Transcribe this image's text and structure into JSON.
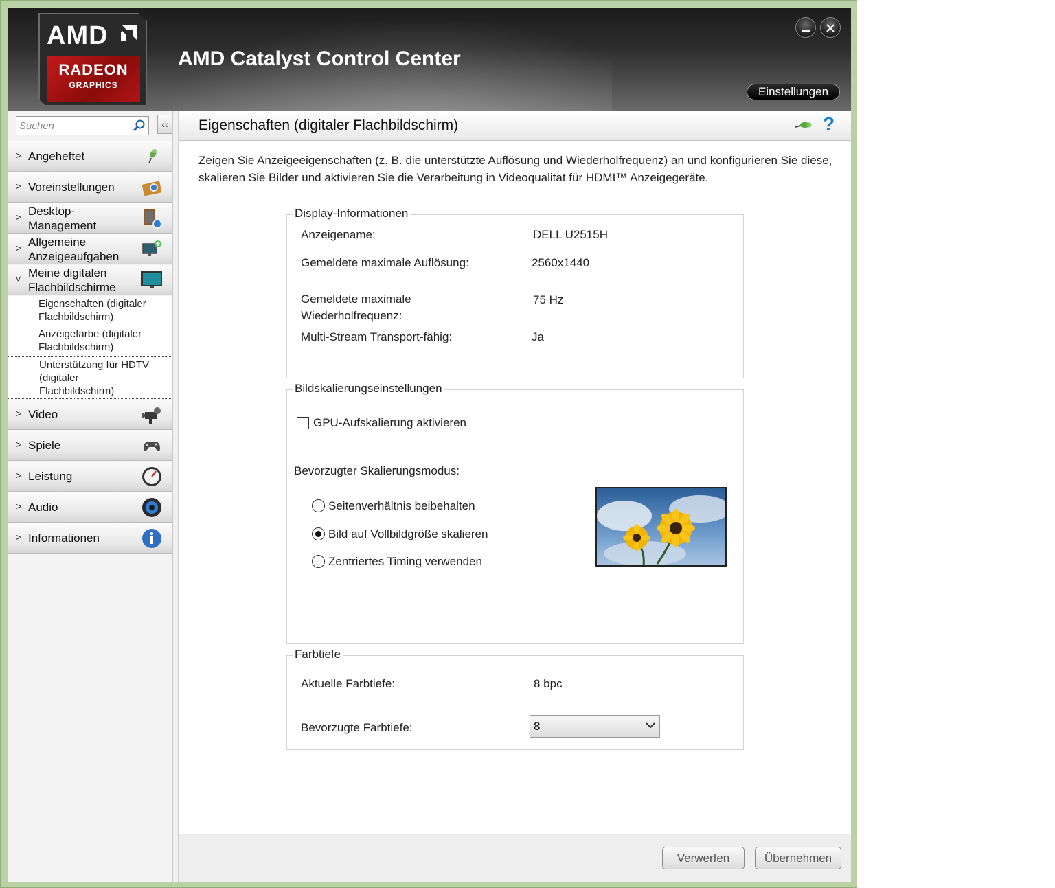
{
  "header": {
    "app_title": "AMD Catalyst Control Center",
    "logo_amd": "AMD",
    "logo_radeon": "RADEON",
    "logo_graphics": "GRAPHICS",
    "minimize_icon": "minimize-icon",
    "close_icon": "close-icon",
    "settings_label": "Einstellungen"
  },
  "sidebar": {
    "search_placeholder": "Suchen",
    "collapse_glyph": "‹‹",
    "items": [
      {
        "label": "Angeheftet",
        "icon": "pin-icon",
        "expanded": false
      },
      {
        "label": "Voreinstellungen",
        "icon": "preset-icon",
        "expanded": false
      },
      {
        "label": "Desktop-Management",
        "line1": "Desktop-",
        "line2": "Management",
        "icon": "desktop-management-icon",
        "expanded": false
      },
      {
        "label": "Allgemeine Anzeigeaufgaben",
        "line1": "Allgemeine",
        "line2": "Anzeigeaufgaben",
        "icon": "display-tasks-icon",
        "expanded": false
      },
      {
        "label": "Meine digitalen Flachbildschirme",
        "line1": "Meine digitalen",
        "line2": "Flachbildschirme",
        "icon": "flatpanel-icon",
        "expanded": true
      },
      {
        "label": "Video",
        "icon": "video-camera-icon",
        "expanded": false
      },
      {
        "label": "Spiele",
        "icon": "gamepad-icon",
        "expanded": false
      },
      {
        "label": "Leistung",
        "icon": "gauge-icon",
        "expanded": false
      },
      {
        "label": "Audio",
        "icon": "speaker-icon",
        "expanded": false
      },
      {
        "label": "Informationen",
        "icon": "info-icon",
        "expanded": false
      }
    ],
    "subitems": [
      {
        "line1": "Eigenschaften (digitaler",
        "line2": "Flachbildschirm)"
      },
      {
        "line1": "Anzeigefarbe (digitaler",
        "line2": "Flachbildschirm)"
      },
      {
        "line1": "Unterstützung für HDTV",
        "line2": "(digitaler",
        "line3": "Flachbildschirm)"
      }
    ]
  },
  "main": {
    "title": "Eigenschaften (digitaler Flachbildschirm)",
    "description": "Zeigen Sie Anzeigeeigenschaften (z. B. die unterstützte Auflösung und Wiederholfrequenz) an und konfigurieren Sie diese, skalieren Sie Bilder und aktivieren Sie die Verarbeitung in Videoqualität für HDMI™ Anzeigegeräte.",
    "display_info": {
      "title": "Display-Informationen",
      "rows": [
        {
          "label": "Anzeigename:",
          "value": "DELL U2515H"
        },
        {
          "label": "Gemeldete maximale Auflösung:",
          "value": "2560x1440"
        },
        {
          "label_line1": "Gemeldete maximale",
          "label_line2": "Wiederholfrequenz:",
          "value": "75 Hz"
        },
        {
          "label": "Multi-Stream Transport-fähig:",
          "value": "Ja"
        }
      ]
    },
    "scaling": {
      "title": "Bildskalierungseinstellungen",
      "gpu_upscaling_label": "GPU-Aufskalierung aktivieren",
      "gpu_upscaling_checked": false,
      "mode_label": "Bevorzugter Skalierungsmodus:",
      "options": [
        {
          "label": "Seitenverhältnis beibehalten",
          "selected": false
        },
        {
          "label": "Bild auf Vollbildgröße skalieren",
          "selected": true
        },
        {
          "label": "Zentriertes Timing verwenden",
          "selected": false
        }
      ]
    },
    "color_depth": {
      "title": "Farbtiefe",
      "current_label": "Aktuelle Farbtiefe:",
      "current_value": "8 bpc",
      "preferred_label": "Bevorzugte Farbtiefe:",
      "preferred_value": "8"
    }
  },
  "footer": {
    "discard_label": "Verwerfen",
    "apply_label": "Übernehmen"
  },
  "colors": {
    "frame": "#b9d1a4",
    "accent_red": "#c41a1a",
    "help_blue": "#1b7fd0"
  }
}
